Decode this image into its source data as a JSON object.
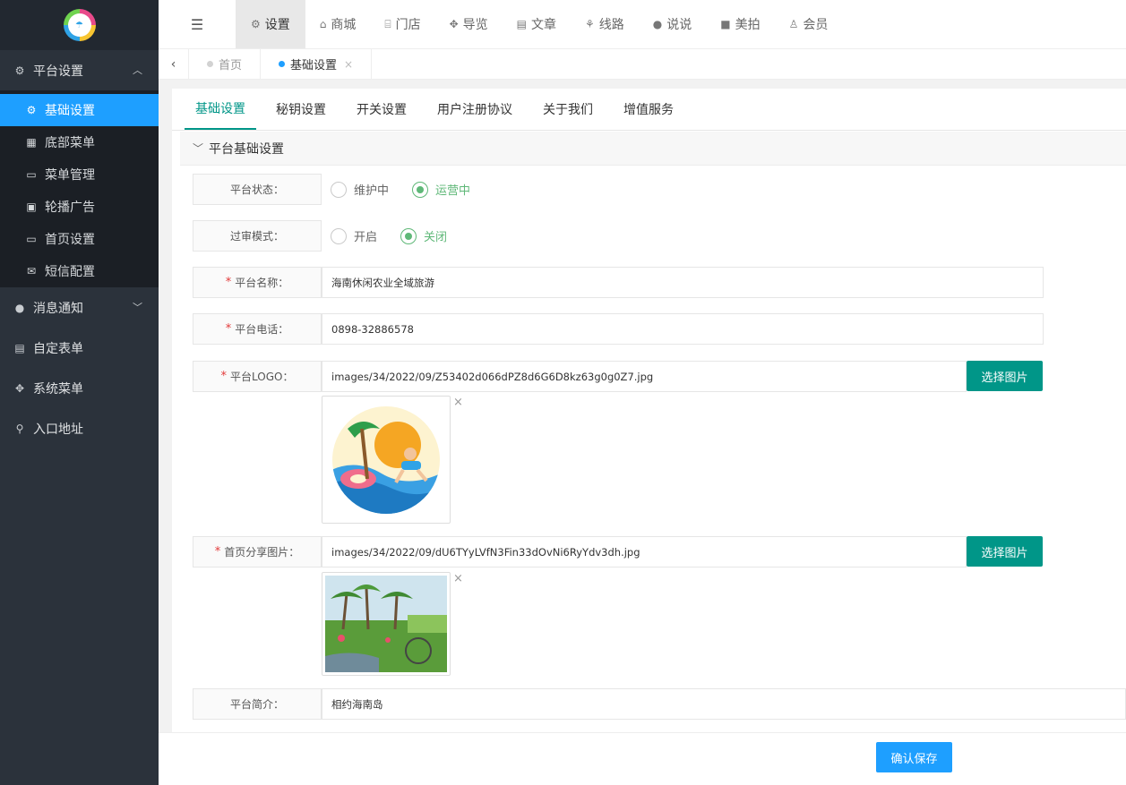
{
  "sidebar": {
    "logo_icon": "beach-logo-icon",
    "groups": [
      {
        "label": "平台设置",
        "icon": "gear-icon",
        "open": true
      },
      {
        "label": "消息通知",
        "icon": "chat-bubble-icon",
        "open": false
      },
      {
        "label": "自定表单",
        "icon": "form-icon"
      },
      {
        "label": "系统菜单",
        "icon": "cluster-icon"
      },
      {
        "label": "入口地址",
        "icon": "search-icon"
      }
    ],
    "sub_items": [
      {
        "label": "基础设置",
        "icon": "gear-icon",
        "active": true
      },
      {
        "label": "底部菜单",
        "icon": "grid-icon"
      },
      {
        "label": "菜单管理",
        "icon": "monitor-icon"
      },
      {
        "label": "轮播广告",
        "icon": "image-icon"
      },
      {
        "label": "首页设置",
        "icon": "monitor-icon"
      },
      {
        "label": "短信配置",
        "icon": "envelope-icon"
      }
    ]
  },
  "topbar": {
    "items": [
      {
        "label": "设置",
        "icon": "gears-icon",
        "active": true
      },
      {
        "label": "商城",
        "icon": "shop-icon"
      },
      {
        "label": "门店",
        "icon": "bank-icon"
      },
      {
        "label": "导览",
        "icon": "cluster-icon"
      },
      {
        "label": "文章",
        "icon": "newspaper-icon"
      },
      {
        "label": "线路",
        "icon": "route-icon"
      },
      {
        "label": "说说",
        "icon": "wechat-icon"
      },
      {
        "label": "美拍",
        "icon": "video-icon"
      },
      {
        "label": "会员",
        "icon": "user-icon"
      }
    ]
  },
  "page_tabs": [
    {
      "label": "首页",
      "active": false
    },
    {
      "label": "基础设置",
      "active": true
    }
  ],
  "sub_tabs": [
    "基础设置",
    "秘钥设置",
    "开关设置",
    "用户注册协议",
    "关于我们",
    "增值服务"
  ],
  "section": {
    "title": "平台基础设置"
  },
  "form": {
    "status": {
      "label": "平台状态：",
      "options": [
        "维护中",
        "运营中"
      ],
      "selected": "运营中"
    },
    "review": {
      "label": "过审模式：",
      "options": [
        "开启",
        "关闭"
      ],
      "selected": "关闭"
    },
    "name": {
      "label": "平台名称：",
      "value": "海南休闲农业全域旅游"
    },
    "phone": {
      "label": "平台电话：",
      "value": "0898-32886578"
    },
    "logo": {
      "label": "平台LOGO：",
      "value": "images/34/2022/09/Z53402d066dPZ8d6G6D8kz63g0g0Z7.jpg",
      "button": "选择图片"
    },
    "share": {
      "label": "首页分享图片：",
      "value": "images/34/2022/09/dU6TYyLVfN3Fin33dOvNi6RyYdv3dh.jpg",
      "button": "选择图片"
    },
    "intro": {
      "label": "平台简介：",
      "value": "相约海南岛"
    }
  },
  "footer": {
    "save_label": "确认保存"
  },
  "colors": {
    "primary": "#1e9fff",
    "teal": "#009688",
    "radio_checked": "#5fb878",
    "sidebar_bg": "#2b323b"
  }
}
